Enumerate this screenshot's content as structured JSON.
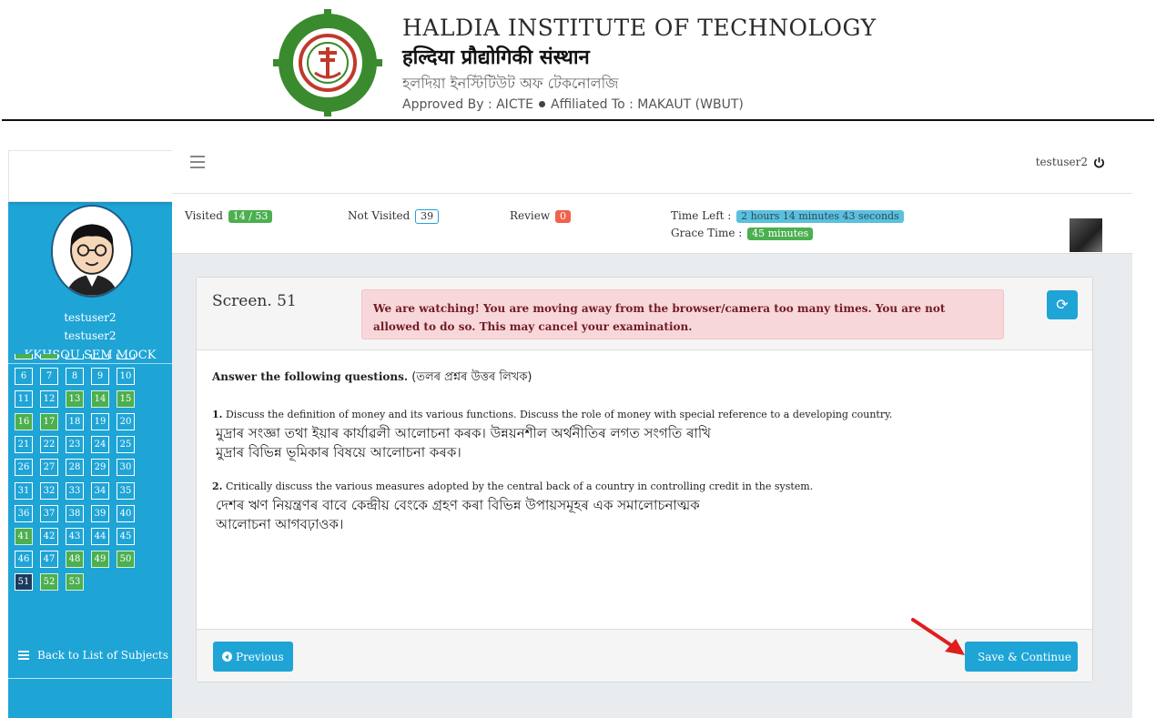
{
  "banner": {
    "name_en": "HALDIA INSTITUTE OF TECHNOLOGY",
    "name_hi": "हल्दिया प्रौद्योगिकी संस्थान",
    "name_bn": "হলদিয়া ইনস্টিটিউট অফ টেকনোলজি",
    "approved_prefix": "Approved By : AICTE",
    "affiliated": "Affiliated To : MAKAUT (WBUT)"
  },
  "topbar": {
    "username": "testuser2"
  },
  "sidebar": {
    "name_line1": "testuser2",
    "name_line2": "testuser2",
    "subject": "KKHSOU SEM MOCK",
    "back_link": "Back to List of Subjects",
    "questions": [
      {
        "n": "6",
        "s": "plain"
      },
      {
        "n": "7",
        "s": "plain"
      },
      {
        "n": "8",
        "s": "plain"
      },
      {
        "n": "9",
        "s": "plain"
      },
      {
        "n": "10",
        "s": "plain"
      },
      {
        "n": "11",
        "s": "plain"
      },
      {
        "n": "12",
        "s": "plain"
      },
      {
        "n": "13",
        "s": "answered"
      },
      {
        "n": "14",
        "s": "answered"
      },
      {
        "n": "15",
        "s": "answered"
      },
      {
        "n": "16",
        "s": "answered"
      },
      {
        "n": "17",
        "s": "answered"
      },
      {
        "n": "18",
        "s": "plain"
      },
      {
        "n": "19",
        "s": "plain"
      },
      {
        "n": "20",
        "s": "plain"
      },
      {
        "n": "21",
        "s": "plain"
      },
      {
        "n": "22",
        "s": "plain"
      },
      {
        "n": "23",
        "s": "plain"
      },
      {
        "n": "24",
        "s": "plain"
      },
      {
        "n": "25",
        "s": "plain"
      },
      {
        "n": "26",
        "s": "plain"
      },
      {
        "n": "27",
        "s": "plain"
      },
      {
        "n": "28",
        "s": "plain"
      },
      {
        "n": "29",
        "s": "plain"
      },
      {
        "n": "30",
        "s": "plain"
      },
      {
        "n": "31",
        "s": "plain"
      },
      {
        "n": "32",
        "s": "plain"
      },
      {
        "n": "33",
        "s": "plain"
      },
      {
        "n": "34",
        "s": "plain"
      },
      {
        "n": "35",
        "s": "plain"
      },
      {
        "n": "36",
        "s": "plain"
      },
      {
        "n": "37",
        "s": "plain"
      },
      {
        "n": "38",
        "s": "plain"
      },
      {
        "n": "39",
        "s": "plain"
      },
      {
        "n": "40",
        "s": "plain"
      },
      {
        "n": "41",
        "s": "answered"
      },
      {
        "n": "42",
        "s": "plain"
      },
      {
        "n": "43",
        "s": "plain"
      },
      {
        "n": "44",
        "s": "plain"
      },
      {
        "n": "45",
        "s": "plain"
      },
      {
        "n": "46",
        "s": "plain"
      },
      {
        "n": "47",
        "s": "plain"
      },
      {
        "n": "48",
        "s": "answered"
      },
      {
        "n": "49",
        "s": "answered"
      },
      {
        "n": "50",
        "s": "answered"
      },
      {
        "n": "51",
        "s": "current"
      },
      {
        "n": "52",
        "s": "answered"
      },
      {
        "n": "53",
        "s": "answered"
      }
    ]
  },
  "status": {
    "visited_label": "Visited",
    "visited_value": "14 / 53",
    "not_visited_label": "Not Visited",
    "not_visited_value": "39",
    "review_label": "Review",
    "review_value": "0",
    "time_left_label": "Time Left :",
    "time_left_value": "2 hours 14 minutes 43 seconds",
    "grace_label": "Grace Time :",
    "grace_value": "45 minutes"
  },
  "card": {
    "screen_title": "Screen. 51",
    "alert": "We are watching! You are moving away from the browser/camera too many times. You are not allowed to do so. This may cancel your examination.",
    "instruction_en": "Answer the following questions.",
    "instruction_bn": " (তলৰ প্ৰশ্নৰ উত্তৰ লিখক)",
    "q1_num": "1.",
    "q1_en": " Discuss the definition of money and its various functions. Discuss the role of money with special reference to a developing country.",
    "q1_bn_1": "মুদ্ৰাৰ সংজ্ঞা তথা ইয়াৰ কাৰ্যাৱলী আলোচনা কৰক। উন্নয়নশীল অৰ্থনীতিৰ লগত সংগতি ৰাখি",
    "q1_bn_2": "মুদ্ৰাৰ বিভিন্ন ভূমিকাৰ বিষয়ে আলোচনা কৰক।",
    "q2_num": "2.",
    "q2_en": " Critically discuss the various measures adopted by the central back of a country in controlling credit in the system.",
    "q2_bn_1": "দেশৰ ঋণ নিয়ন্ত্ৰণৰ বাবে কেন্দ্ৰীয় বেংকে গ্ৰহণ কৰা বিভিন্ন উপায়সমূহৰ এক সমালোচনাত্মক",
    "q2_bn_2": "আলোচনা আগবঢ়াওক।",
    "previous_label": "Previous",
    "save_label": "Save & Continue"
  },
  "colors": {
    "sidebar": "#1fa4d6",
    "answered": "#4caf50",
    "current": "#1c3a5c",
    "alert_bg": "#f8d7da",
    "arrow": "#e01e1e"
  }
}
